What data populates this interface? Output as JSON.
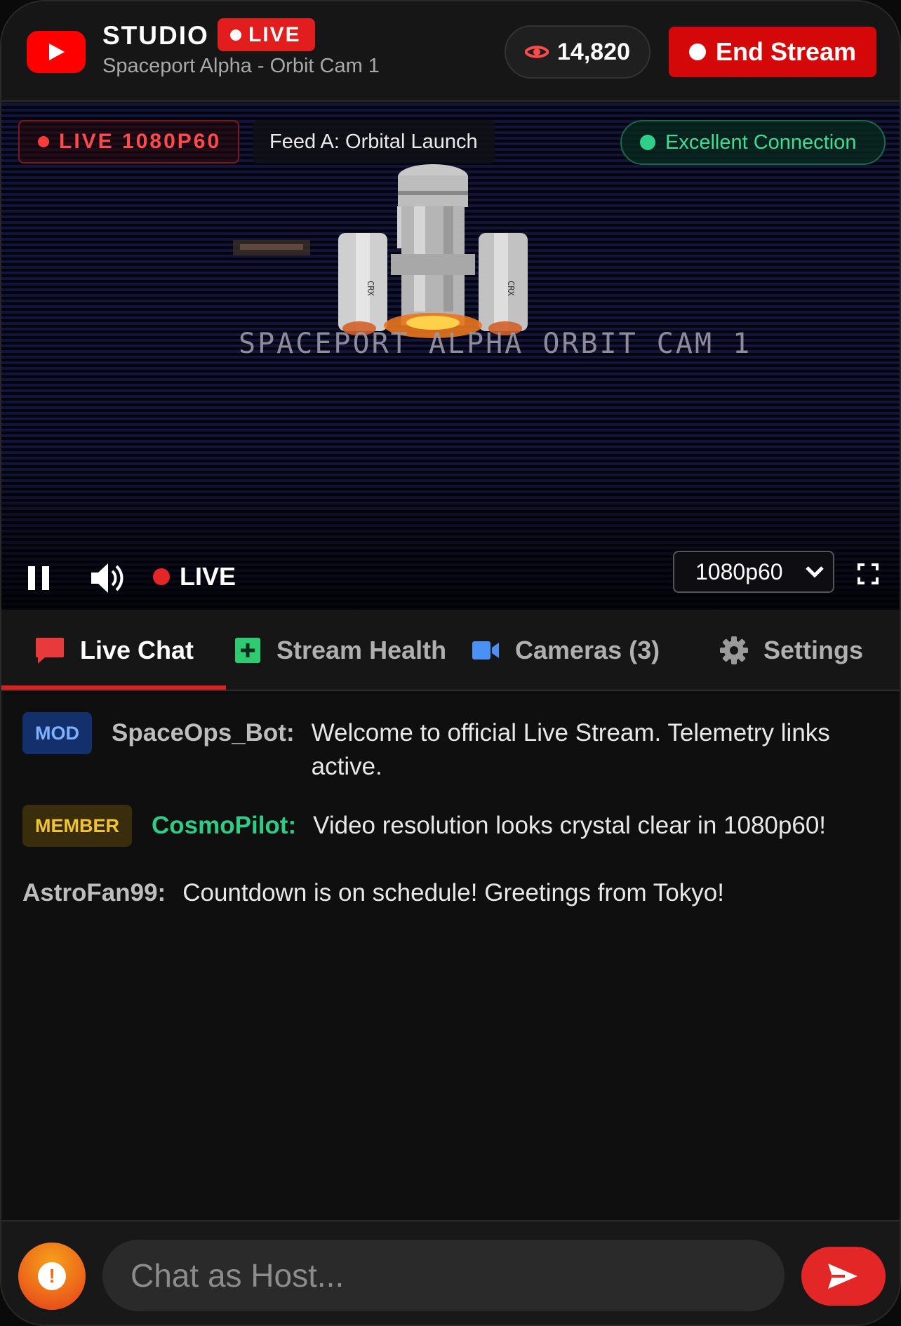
{
  "header": {
    "studio_label": "STUDIO",
    "live_badge": "LIVE",
    "subtitle": "Spaceport Alpha - Orbit Cam 1",
    "viewer_count": "14,820",
    "end_stream_label": "End Stream"
  },
  "video": {
    "live_quality_badge": "LIVE 1080P60",
    "feed_label": "Feed A: Orbital Launch",
    "connection_status": "Excellent Connection",
    "overlay_text": "SPACEPORT ALPHA  ORBIT CAM 1",
    "controls": {
      "live_label": "LIVE",
      "quality_selected": "1080p60"
    }
  },
  "tabs": [
    {
      "label": "Live Chat",
      "icon": "chat-bubble-icon",
      "active": true
    },
    {
      "label": "Stream Health",
      "icon": "plus-square-icon",
      "active": false
    },
    {
      "label": "Cameras (3)",
      "icon": "video-camera-icon",
      "active": false
    },
    {
      "label": "Settings",
      "icon": "gear-icon",
      "active": false
    }
  ],
  "chat": {
    "messages": [
      {
        "badge": "MOD",
        "user": "SpaceOps_Bot:",
        "text": "Welcome to official Live Stream. Telemetry links active."
      },
      {
        "badge": "MEMBER",
        "user": "CosmoPilot:",
        "text": "Video resolution looks crystal clear in 1080p60!"
      },
      {
        "badge": "",
        "user": "AstroFan99:",
        "text": "Countdown is on schedule! Greetings from Tokyo!"
      }
    ]
  },
  "footer": {
    "input_placeholder": "Chat as Host...",
    "avatar_glyph": "!"
  },
  "colors": {
    "accent_red": "#e21d1d",
    "connection_green": "#3ddc97",
    "mod_blue": "#7fb0ff",
    "member_gold": "#f1c232",
    "cosmopilot_green": "#2ecc85",
    "username_gray": "#bdbdbd"
  }
}
